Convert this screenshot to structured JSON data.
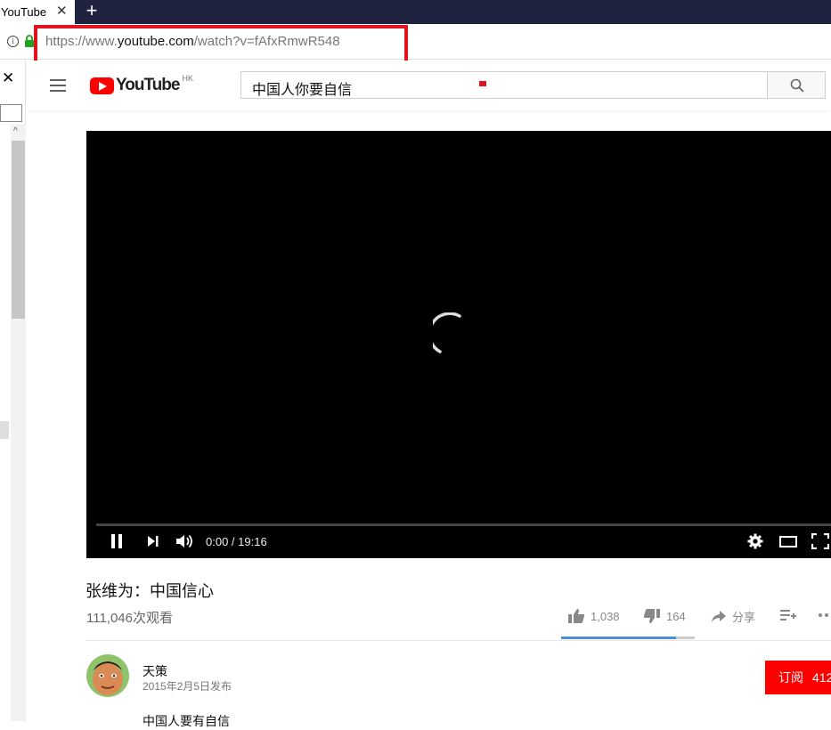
{
  "browser": {
    "tab_title": "YouTube",
    "tab_close": "✕",
    "new_tab": "+",
    "url_scheme": "https://www.",
    "url_host": "youtube.com",
    "url_path": "/watch?v=fAfxRmwR548"
  },
  "side_panel": {
    "close": "✕",
    "scroll_up": "^"
  },
  "header": {
    "logo_text": "YouTube",
    "logo_region": "HK",
    "search_value": "中国人你要自信",
    "brand_color": "#ff0000"
  },
  "player": {
    "time": "0:00 / 19:16",
    "progress": 0.0,
    "state": "loading",
    "icons": [
      "pause-icon",
      "next-icon",
      "volume-icon",
      "settings-icon",
      "theater-icon",
      "fullscreen-icon"
    ]
  },
  "video": {
    "title": "张维为：中国信心",
    "views": "111,046次观看",
    "likes": "1,038",
    "dislikes": "164",
    "share_label": "分享",
    "like_ratio": 0.86
  },
  "channel": {
    "name": "天策",
    "published": "2015年2月5日发布",
    "subscribe_label": "订阅",
    "subscriber_count": "412",
    "description_line": "中国人要有自信"
  },
  "annotation": {
    "highlight_color": "#e0131f"
  }
}
